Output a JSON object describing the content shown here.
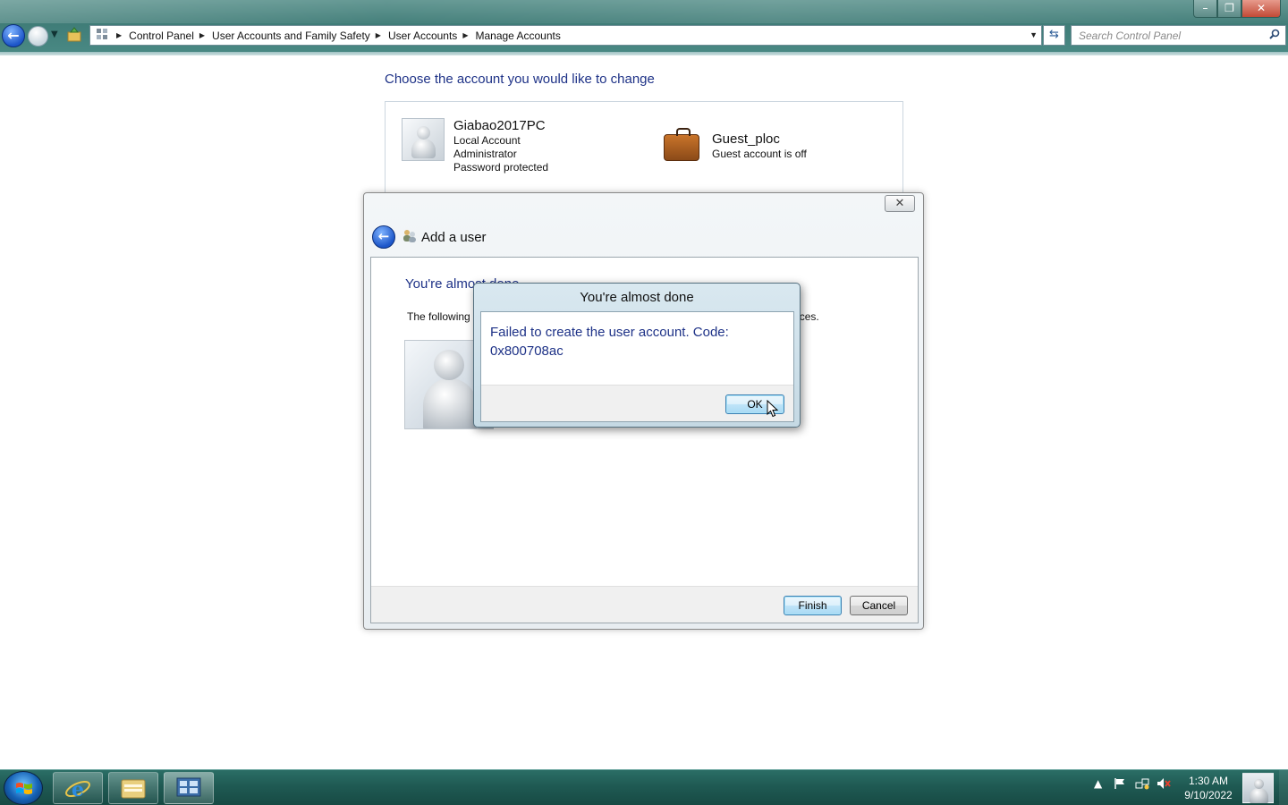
{
  "window": {
    "controls": {
      "minimize": "–",
      "maximize": "❐",
      "close": "✕"
    }
  },
  "addressbar": {
    "breadcrumbs": [
      "Control Panel",
      "User Accounts and Family Safety",
      "User Accounts",
      "Manage Accounts"
    ],
    "search_placeholder": "Search Control Panel"
  },
  "main": {
    "heading": "Choose the account you would like to change",
    "accounts": [
      {
        "name": "Giabao2017PC",
        "lines": [
          "Local Account",
          "Administrator",
          "Password protected"
        ]
      },
      {
        "name": "Guest_ploc",
        "lines": [
          "Guest account is off"
        ]
      }
    ]
  },
  "add_user_dialog": {
    "title": "Add a user",
    "close": "✕",
    "heading_visible": "You're alm",
    "heading_tail": "ost done",
    "body_start": "The following u",
    "body_end": "rces.",
    "finish_label": "Finish",
    "cancel_label": "Cancel"
  },
  "message_box": {
    "title": "You're almost done",
    "message": "Failed to create the user account.  Code: 0x800708ac",
    "ok_label": "OK"
  },
  "taskbar": {
    "time": "1:30 AM",
    "date": "9/10/2022",
    "colors": {
      "accent": "#1e3287",
      "taskbar": "#1f5a53"
    }
  }
}
